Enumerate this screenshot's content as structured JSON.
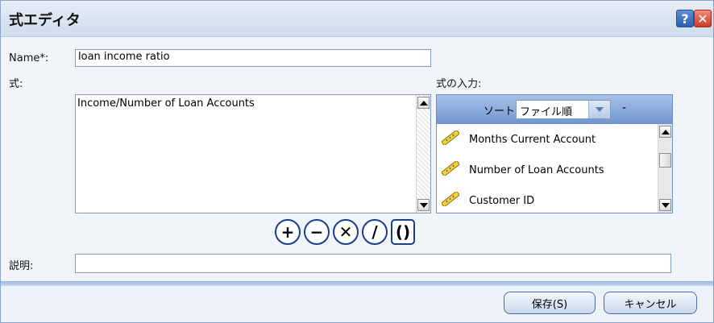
{
  "dialog": {
    "title": "式エディタ",
    "help_glyph": "?",
    "close_glyph": "✕"
  },
  "form": {
    "name_label": "Name*:",
    "name_value": "loan income ratio",
    "expression_label": "式:",
    "expression_value": "Income/Number of Loan Accounts",
    "input_label": "式の入力:",
    "description_label": "説明:",
    "description_value": ""
  },
  "field_panel": {
    "sort_label": "ソート",
    "sort_value": "ファイル順",
    "dash": "-",
    "items": [
      {
        "label": "Months Current Account",
        "icon": "ruler-icon"
      },
      {
        "label": "Number of Loan Accounts",
        "icon": "ruler-icon"
      },
      {
        "label": "Customer ID",
        "icon": "ruler-icon"
      }
    ]
  },
  "operators": [
    "+",
    "−",
    "✕",
    "/",
    "()"
  ],
  "buttons": {
    "save": "保存(S)",
    "cancel": "キャンセル"
  },
  "colors": {
    "operator_border": "#1a3d8c",
    "panel_header": "#6e95cf",
    "close_red": "#c93b2c",
    "help_blue": "#2c5fae"
  }
}
